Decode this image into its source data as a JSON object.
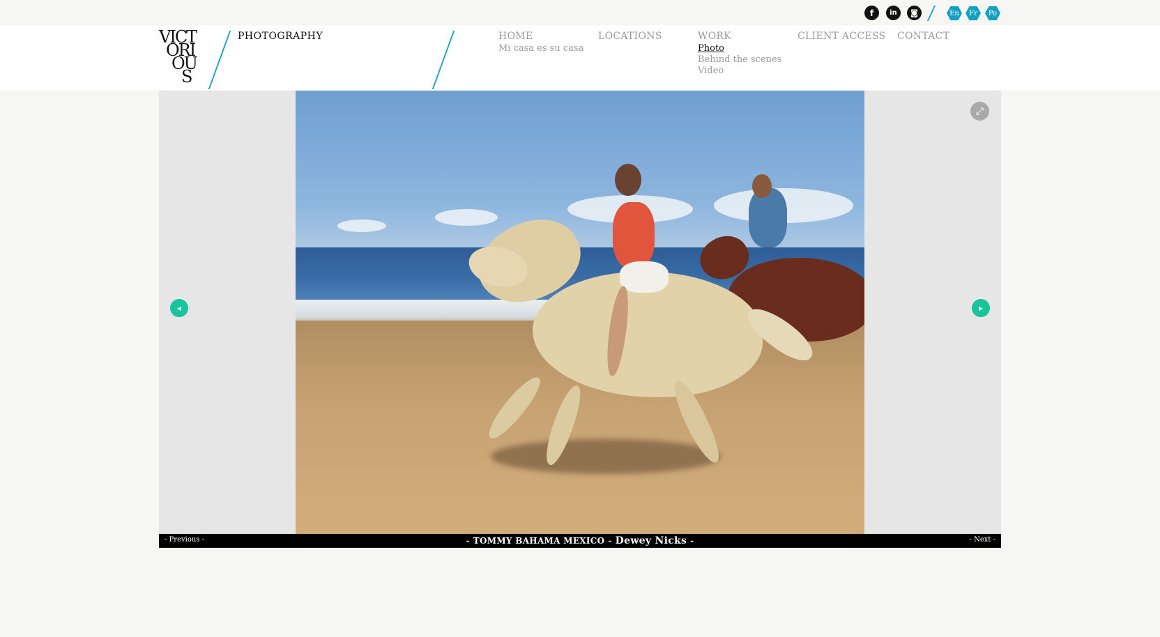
{
  "social": {
    "facebook_glyph": "f",
    "linkedin_glyph": "in",
    "instagram_glyph": "◙"
  },
  "languages": [
    "En",
    "Fr",
    "Po"
  ],
  "logo": {
    "lines": [
      "VICT",
      "ORI",
      "OU",
      "S"
    ],
    "subtitle": "PHOTOGRAPHY"
  },
  "nav": {
    "home": {
      "label": "HOME",
      "sub": [
        "Mi casa es su casa"
      ]
    },
    "locations": {
      "label": "LOCATIONS"
    },
    "work": {
      "label": "WORK",
      "sub": [
        "Photo",
        "Behind the scenes",
        "Video"
      ],
      "active": "Photo"
    },
    "client_access": {
      "label": "CLIENT ACCESS"
    },
    "contact": {
      "label": "CONTACT"
    }
  },
  "gallery": {
    "prev_arrow": "◂",
    "next_arrow": "▸",
    "fullscreen_glyph": "⤢"
  },
  "caption": {
    "previous": "-  Previous  -",
    "next": "-  Next  -",
    "client": "TOMMY BAHAMA MEXICO",
    "photographer": "Dewey Nicks",
    "dash": "-"
  },
  "colors": {
    "accent_blue": "#1aa0c8",
    "arrow_green": "#18c49a",
    "caption_bg": "#000000"
  }
}
